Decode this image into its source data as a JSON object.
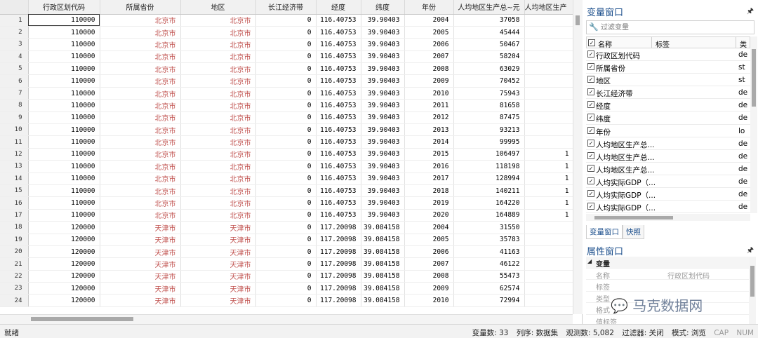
{
  "grid": {
    "columns": [
      "行政区划代码",
      "所属省份",
      "地区",
      "长江经济带",
      "经度",
      "纬度",
      "年份",
      "人均地区生产总~元",
      "人均地区生产"
    ],
    "rows": [
      {
        "n": "1",
        "c": "110000",
        "p": "北京市",
        "r": "北京市",
        "y": "0",
        "lon": "116.40753",
        "lat": "39.90403",
        "yr": "2004",
        "g": "37058",
        "x": ""
      },
      {
        "n": "2",
        "c": "110000",
        "p": "北京市",
        "r": "北京市",
        "y": "0",
        "lon": "116.40753",
        "lat": "39.90403",
        "yr": "2005",
        "g": "45444",
        "x": ""
      },
      {
        "n": "3",
        "c": "110000",
        "p": "北京市",
        "r": "北京市",
        "y": "0",
        "lon": "116.40753",
        "lat": "39.90403",
        "yr": "2006",
        "g": "50467",
        "x": ""
      },
      {
        "n": "4",
        "c": "110000",
        "p": "北京市",
        "r": "北京市",
        "y": "0",
        "lon": "116.40753",
        "lat": "39.90403",
        "yr": "2007",
        "g": "58204",
        "x": ""
      },
      {
        "n": "5",
        "c": "110000",
        "p": "北京市",
        "r": "北京市",
        "y": "0",
        "lon": "116.40753",
        "lat": "39.90403",
        "yr": "2008",
        "g": "63029",
        "x": ""
      },
      {
        "n": "6",
        "c": "110000",
        "p": "北京市",
        "r": "北京市",
        "y": "0",
        "lon": "116.40753",
        "lat": "39.90403",
        "yr": "2009",
        "g": "70452",
        "x": ""
      },
      {
        "n": "7",
        "c": "110000",
        "p": "北京市",
        "r": "北京市",
        "y": "0",
        "lon": "116.40753",
        "lat": "39.90403",
        "yr": "2010",
        "g": "75943",
        "x": ""
      },
      {
        "n": "8",
        "c": "110000",
        "p": "北京市",
        "r": "北京市",
        "y": "0",
        "lon": "116.40753",
        "lat": "39.90403",
        "yr": "2011",
        "g": "81658",
        "x": ""
      },
      {
        "n": "9",
        "c": "110000",
        "p": "北京市",
        "r": "北京市",
        "y": "0",
        "lon": "116.40753",
        "lat": "39.90403",
        "yr": "2012",
        "g": "87475",
        "x": ""
      },
      {
        "n": "10",
        "c": "110000",
        "p": "北京市",
        "r": "北京市",
        "y": "0",
        "lon": "116.40753",
        "lat": "39.90403",
        "yr": "2013",
        "g": "93213",
        "x": ""
      },
      {
        "n": "11",
        "c": "110000",
        "p": "北京市",
        "r": "北京市",
        "y": "0",
        "lon": "116.40753",
        "lat": "39.90403",
        "yr": "2014",
        "g": "99995",
        "x": ""
      },
      {
        "n": "12",
        "c": "110000",
        "p": "北京市",
        "r": "北京市",
        "y": "0",
        "lon": "116.40753",
        "lat": "39.90403",
        "yr": "2015",
        "g": "106497",
        "x": "1"
      },
      {
        "n": "13",
        "c": "110000",
        "p": "北京市",
        "r": "北京市",
        "y": "0",
        "lon": "116.40753",
        "lat": "39.90403",
        "yr": "2016",
        "g": "118198",
        "x": "1"
      },
      {
        "n": "14",
        "c": "110000",
        "p": "北京市",
        "r": "北京市",
        "y": "0",
        "lon": "116.40753",
        "lat": "39.90403",
        "yr": "2017",
        "g": "128994",
        "x": "1"
      },
      {
        "n": "15",
        "c": "110000",
        "p": "北京市",
        "r": "北京市",
        "y": "0",
        "lon": "116.40753",
        "lat": "39.90403",
        "yr": "2018",
        "g": "140211",
        "x": "1"
      },
      {
        "n": "16",
        "c": "110000",
        "p": "北京市",
        "r": "北京市",
        "y": "0",
        "lon": "116.40753",
        "lat": "39.90403",
        "yr": "2019",
        "g": "164220",
        "x": "1"
      },
      {
        "n": "17",
        "c": "110000",
        "p": "北京市",
        "r": "北京市",
        "y": "0",
        "lon": "116.40753",
        "lat": "39.90403",
        "yr": "2020",
        "g": "164889",
        "x": "1"
      },
      {
        "n": "18",
        "c": "120000",
        "p": "天津市",
        "r": "天津市",
        "y": "0",
        "lon": "117.20098",
        "lat": "39.084158",
        "yr": "2004",
        "g": "31550",
        "x": ""
      },
      {
        "n": "19",
        "c": "120000",
        "p": "天津市",
        "r": "天津市",
        "y": "0",
        "lon": "117.20098",
        "lat": "39.084158",
        "yr": "2005",
        "g": "35783",
        "x": ""
      },
      {
        "n": "20",
        "c": "120000",
        "p": "天津市",
        "r": "天津市",
        "y": "0",
        "lon": "117.20098",
        "lat": "39.084158",
        "yr": "2006",
        "g": "41163",
        "x": ""
      },
      {
        "n": "21",
        "c": "120000",
        "p": "天津市",
        "r": "天津市",
        "y": "0",
        "lon": "117.20098",
        "lat": "39.084158",
        "yr": "2007",
        "g": "46122",
        "x": ""
      },
      {
        "n": "22",
        "c": "120000",
        "p": "天津市",
        "r": "天津市",
        "y": "0",
        "lon": "117.20098",
        "lat": "39.084158",
        "yr": "2008",
        "g": "55473",
        "x": ""
      },
      {
        "n": "23",
        "c": "120000",
        "p": "天津市",
        "r": "天津市",
        "y": "0",
        "lon": "117.20098",
        "lat": "39.084158",
        "yr": "2009",
        "g": "62574",
        "x": ""
      },
      {
        "n": "24",
        "c": "120000",
        "p": "天津市",
        "r": "天津市",
        "y": "0",
        "lon": "117.20098",
        "lat": "39.084158",
        "yr": "2010",
        "g": "72994",
        "x": ""
      }
    ]
  },
  "var_panel": {
    "title": "变量窗口",
    "filter_placeholder": "过滤变量",
    "col_name": "名称",
    "col_label": "标签",
    "col_type": "类",
    "items": [
      {
        "name": "行政区划代码",
        "type": "de"
      },
      {
        "name": "所属省份",
        "type": "st"
      },
      {
        "name": "地区",
        "type": "st"
      },
      {
        "name": "长江经济带",
        "type": "de"
      },
      {
        "name": "经度",
        "type": "de"
      },
      {
        "name": "纬度",
        "type": "de"
      },
      {
        "name": "年份",
        "type": "lo"
      },
      {
        "name": "人均地区生产总...",
        "type": "de"
      },
      {
        "name": "人均地区生产总...",
        "type": "de"
      },
      {
        "name": "人均地区生产总...",
        "type": "de"
      },
      {
        "name": "人均实际GDP（...",
        "type": "de"
      },
      {
        "name": "人均实际GDP（...",
        "type": "de"
      },
      {
        "name": "人均实际GDP（...",
        "type": "de"
      }
    ],
    "tabs": [
      "变量窗口",
      "快照"
    ]
  },
  "prop_panel": {
    "title": "属性窗口",
    "section": "变量",
    "rows": [
      {
        "k": "名称",
        "v": "行政区划代码"
      },
      {
        "k": "标签",
        "v": ""
      },
      {
        "k": "类型",
        "v": ""
      },
      {
        "k": "格式",
        "v": ""
      },
      {
        "k": "值标签",
        "v": ""
      }
    ]
  },
  "status": {
    "ready": "就绪",
    "vars": "变量数: 33",
    "order": "列序: 数据集",
    "obs": "观测数: 5,082",
    "filter": "过滤器: 关闭",
    "mode": "模式: 浏览",
    "cap": "CAP",
    "num": "NUM"
  },
  "watermark": "马克数据网"
}
